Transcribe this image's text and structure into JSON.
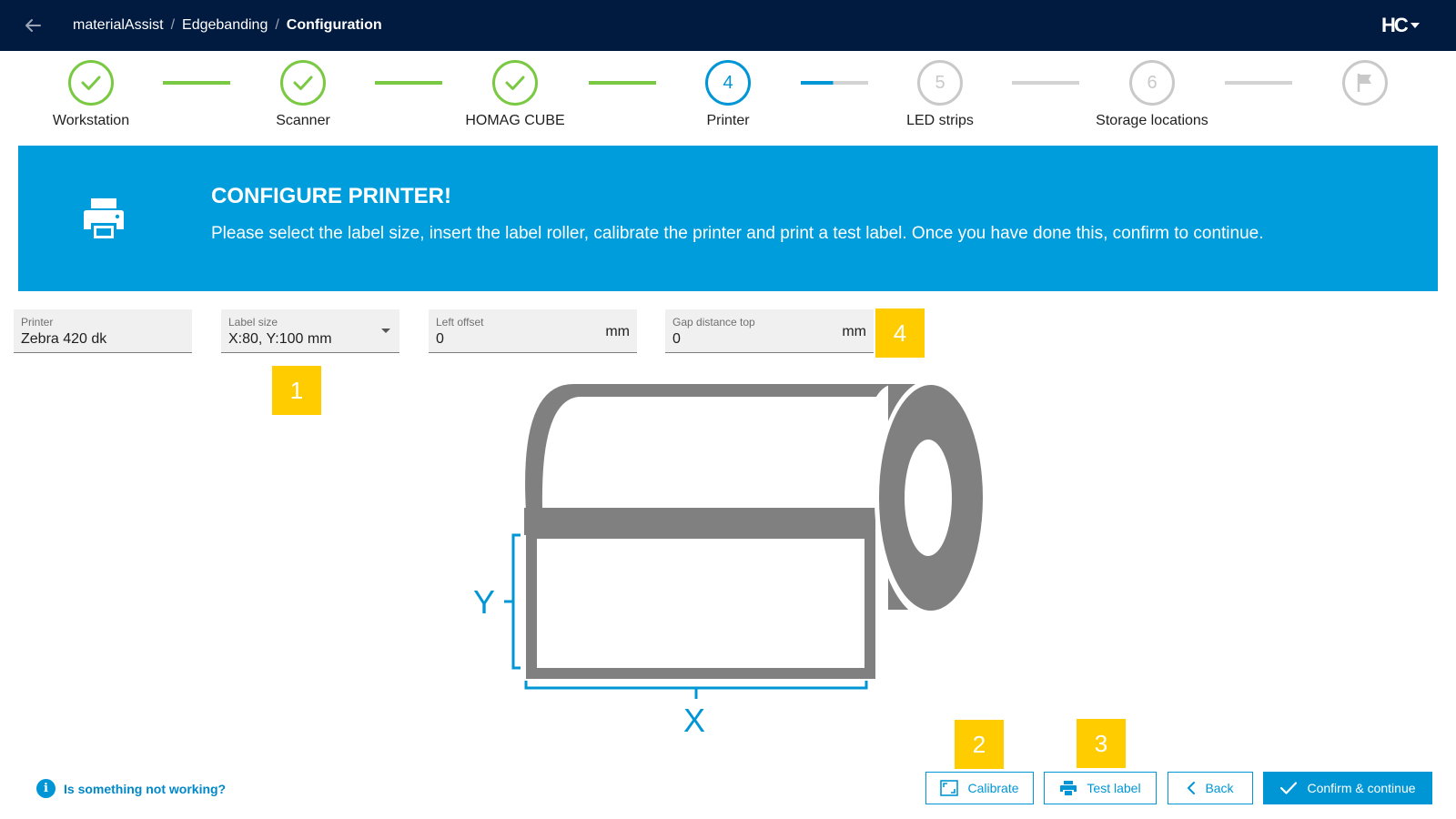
{
  "header": {
    "breadcrumb": [
      "materialAssist",
      "Edgebanding",
      "Configuration"
    ],
    "brand": "HC"
  },
  "stepper": {
    "steps": [
      {
        "label": "Workstation",
        "state": "done",
        "number": ""
      },
      {
        "label": "Scanner",
        "state": "done",
        "number": ""
      },
      {
        "label": "HOMAG CUBE",
        "state": "done",
        "number": ""
      },
      {
        "label": "Printer",
        "state": "active",
        "number": "4"
      },
      {
        "label": "LED strips",
        "state": "pending",
        "number": "5"
      },
      {
        "label": "Storage locations",
        "state": "pending",
        "number": "6"
      },
      {
        "label": "",
        "state": "pending",
        "number": "",
        "icon": "flag-icon"
      }
    ]
  },
  "banner": {
    "title": "CONFIGURE PRINTER!",
    "text": "Please select the label size, insert the label roller, calibrate the printer and print a test label. Once you have done this, confirm to continue.",
    "icon": "printer-icon",
    "color": "#009ddc"
  },
  "form": {
    "printer": {
      "label": "Printer",
      "value": "Zebra 420 dk"
    },
    "label_size": {
      "label": "Label size",
      "value": "X:80, Y:100 mm"
    },
    "left_offset": {
      "label": "Left offset",
      "value": "0",
      "unit": "mm"
    },
    "gap_distance_top": {
      "label": "Gap distance top",
      "value": "0",
      "unit": "mm"
    }
  },
  "markers": [
    "1",
    "2",
    "3",
    "4"
  ],
  "illustration": {
    "y_label": "Y",
    "x_label": "X"
  },
  "footer": {
    "help_text": "Is something not working?",
    "calibrate_label": "Calibrate",
    "test_label": "Test label",
    "back_label": "Back",
    "confirm_label": "Confirm & continue"
  },
  "colors": {
    "header_bg": "#001a40",
    "accent": "#0096d6",
    "done": "#7ac943",
    "marker": "#ffcc00"
  }
}
